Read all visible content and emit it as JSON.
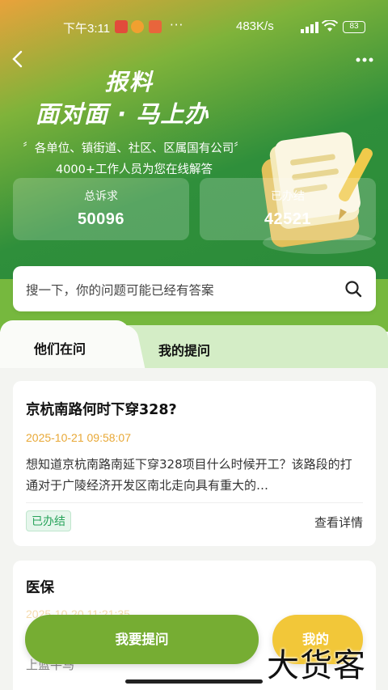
{
  "status_bar": {
    "time": "下午3:11",
    "network_speed": "483K/s",
    "more_dots": "···",
    "battery": "83"
  },
  "header": {
    "title_line1": "报料",
    "title_line2": "面对面 · 马上办",
    "subtitle_line1": "〞各单位、镇街道、社区、区属国有公司〞",
    "subtitle_line2": "4000+工作人员为您在线解答",
    "back_icon": "chevron-left-icon",
    "more_icon": "more-horizontal-icon"
  },
  "stats": {
    "total_label": "总诉求",
    "total_value": "50096",
    "done_label": "已办结",
    "done_value": "42521"
  },
  "search": {
    "placeholder": "搜一下，你的问题可能已经有答案",
    "icon": "search-icon"
  },
  "tabs": {
    "active": "他们在问",
    "other": "我的提问"
  },
  "questions": [
    {
      "title": "京杭南路何时下穿328?",
      "date": "2025-10-21 09:58:07",
      "desc": "想知道京杭南路南延下穿328项目什么时候开工？该路段的打通对于广陵经济开发区南北走向具有重大的…",
      "status": "已办结",
      "detail": "查看详情"
    },
    {
      "title": "医保",
      "date": "2025-10-20 11:21:35",
      "partial": "上蓝牛马"
    }
  ],
  "actions": {
    "ask": "我要提问",
    "mine": "我的"
  },
  "watermark": "大货客",
  "colors": {
    "accent_green": "#76ad33",
    "hero_green": "#2f8f3b",
    "date_orange": "#e8a836",
    "badge_green": "#27a35a",
    "mine_yellow": "#f2c739"
  }
}
